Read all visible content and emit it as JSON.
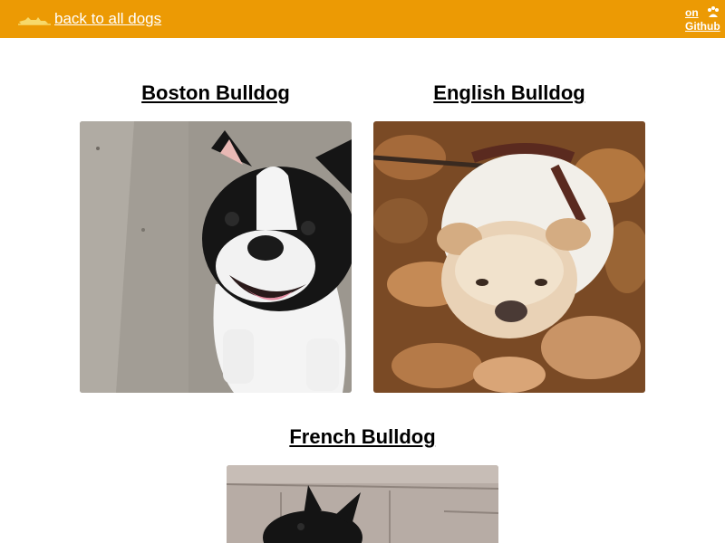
{
  "header": {
    "back_label": "back to all dogs",
    "github_line1": "on",
    "github_line2": "Github",
    "background": "#ec9a04",
    "back_icon": "dog-icon",
    "github_icon": "paw-icon"
  },
  "breeds": [
    {
      "name": "Boston Bulldog"
    },
    {
      "name": "English Bulldog"
    },
    {
      "name": "French Bulldog"
    }
  ]
}
